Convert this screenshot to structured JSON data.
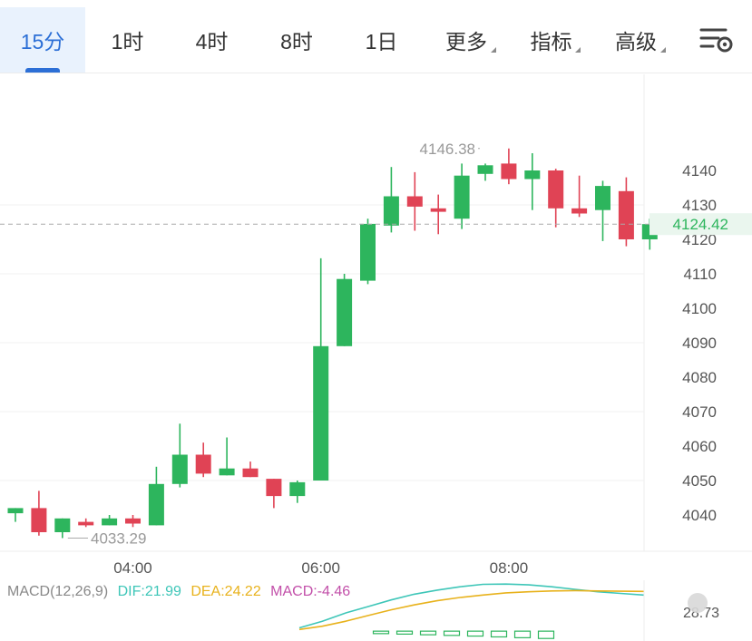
{
  "tabs": [
    {
      "label": "15分",
      "active": true,
      "dropdown": false
    },
    {
      "label": "1时",
      "active": false,
      "dropdown": false
    },
    {
      "label": "4时",
      "active": false,
      "dropdown": false
    },
    {
      "label": "8时",
      "active": false,
      "dropdown": false
    },
    {
      "label": "1日",
      "active": false,
      "dropdown": false
    },
    {
      "label": "更多",
      "active": false,
      "dropdown": true
    },
    {
      "label": "指标",
      "active": false,
      "dropdown": true
    },
    {
      "label": "高级",
      "active": false,
      "dropdown": true
    }
  ],
  "icons": {
    "settings": "chart-settings-icon"
  },
  "colors": {
    "up": "#2db55d",
    "down": "#e04355",
    "accent": "#2c6fd6",
    "dif": "#3ec6b8",
    "dea": "#e8b21c",
    "macd": "#c24fa9"
  },
  "chart_data": {
    "type": "candlestick",
    "ylim": [
      4030,
      4160
    ],
    "yticks": [
      4040,
      4050,
      4060,
      4070,
      4080,
      4090,
      4100,
      4110,
      4120,
      4130,
      4140
    ],
    "x_labels": [
      {
        "label": "04:00",
        "index": 5
      },
      {
        "label": "06:00",
        "index": 13
      },
      {
        "label": "08:00",
        "index": 21
      }
    ],
    "current_price": {
      "label": "4124.42",
      "value": 4124.42
    },
    "max_marker": {
      "label": "4146.38",
      "value": 4146.38,
      "index": 20
    },
    "min_marker": {
      "label": "4033.29",
      "value": 4033.29,
      "index": 2
    },
    "candles": [
      {
        "o": 4040.5,
        "h": 4042,
        "l": 4038,
        "c": 4042
      },
      {
        "o": 4042,
        "h": 4047,
        "l": 4034,
        "c": 4035
      },
      {
        "o": 4035,
        "h": 4039,
        "l": 4033.29,
        "c": 4039
      },
      {
        "o": 4038,
        "h": 4039,
        "l": 4036.5,
        "c": 4037
      },
      {
        "o": 4037,
        "h": 4040,
        "l": 4037,
        "c": 4039
      },
      {
        "o": 4039,
        "h": 4040,
        "l": 4036.5,
        "c": 4037.5
      },
      {
        "o": 4037,
        "h": 4054,
        "l": 4037,
        "c": 4049
      },
      {
        "o": 4049,
        "h": 4066.5,
        "l": 4048,
        "c": 4057.5
      },
      {
        "o": 4057.5,
        "h": 4061,
        "l": 4051,
        "c": 4052
      },
      {
        "o": 4051.5,
        "h": 4062.5,
        "l": 4051.5,
        "c": 4053.5
      },
      {
        "o": 4053.5,
        "h": 4055.5,
        "l": 4051,
        "c": 4051
      },
      {
        "o": 4050.5,
        "h": 4050.5,
        "l": 4042,
        "c": 4045.5
      },
      {
        "o": 4045.5,
        "h": 4050,
        "l": 4043.5,
        "c": 4049.5
      },
      {
        "o": 4050,
        "h": 4114.5,
        "l": 4050,
        "c": 4089
      },
      {
        "o": 4089,
        "h": 4110,
        "l": 4089,
        "c": 4108.5
      },
      {
        "o": 4108,
        "h": 4126,
        "l": 4107,
        "c": 4124.5
      },
      {
        "o": 4124,
        "h": 4141,
        "l": 4122,
        "c": 4132.5
      },
      {
        "o": 4132.5,
        "h": 4139.5,
        "l": 4122.5,
        "c": 4129.5
      },
      {
        "o": 4129,
        "h": 4133,
        "l": 4121.5,
        "c": 4128
      },
      {
        "o": 4126,
        "h": 4142,
        "l": 4123,
        "c": 4138.5
      },
      {
        "o": 4139,
        "h": 4142,
        "l": 4137,
        "c": 4141.5
      },
      {
        "o": 4142,
        "h": 4146.38,
        "l": 4136,
        "c": 4137.5
      },
      {
        "o": 4137.5,
        "h": 4145,
        "l": 4128.5,
        "c": 4140
      },
      {
        "o": 4140,
        "h": 4140.5,
        "l": 4123.5,
        "c": 4129
      },
      {
        "o": 4129,
        "h": 4138.5,
        "l": 4126.5,
        "c": 4127.5
      },
      {
        "o": 4128.5,
        "h": 4137,
        "l": 4119.5,
        "c": 4135.5
      },
      {
        "o": 4134,
        "h": 4138,
        "l": 4118,
        "c": 4120
      },
      {
        "o": 4120,
        "h": 4126,
        "l": 4117,
        "c": 4124.42
      }
    ],
    "macd": {
      "label": "MACD(12,26,9)",
      "dif": "DIF:21.99",
      "dea": "DEA:24.22",
      "macd": "MACD:-4.46",
      "axis_label": "28.73",
      "ylim": [
        -6,
        31
      ],
      "dif_series": [
        2,
        6,
        11,
        15,
        19,
        22.5,
        25,
        27,
        28.5,
        28.7,
        28.2,
        27,
        25.5,
        24,
        23,
        22
      ],
      "dea_series": [
        1,
        3,
        6,
        9.5,
        13,
        16,
        18.5,
        20.5,
        22,
        23.3,
        24,
        24.5,
        24.7,
        24.5,
        24.3,
        24.2
      ],
      "hist": [
        -1.5,
        -1.8,
        -2.2,
        -2.6,
        -3,
        -3.5,
        -4,
        -4.46
      ]
    }
  }
}
